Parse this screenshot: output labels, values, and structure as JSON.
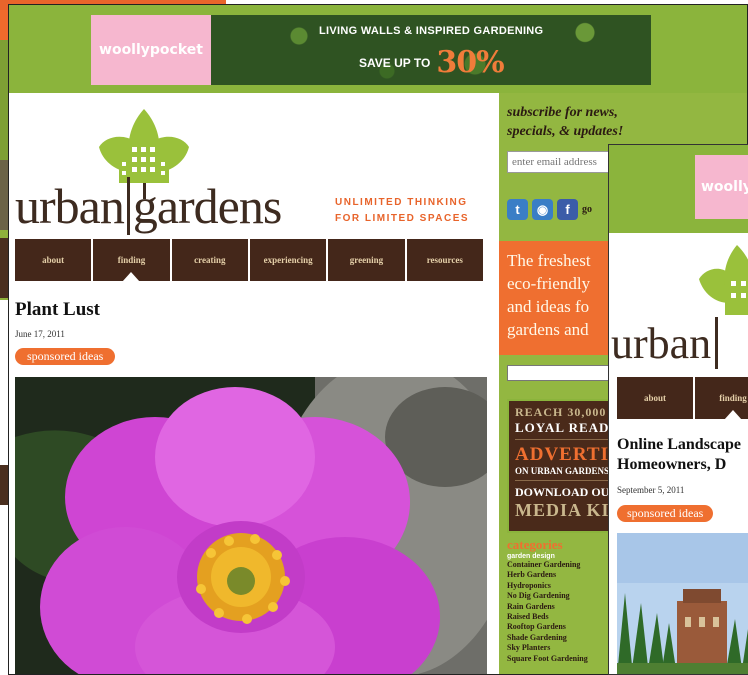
{
  "ad": {
    "logo": "woollypocket",
    "headline": "LIVING WALLS & INSPIRED GARDENING",
    "save_text": "SAVE UP TO",
    "save_percent": "30%"
  },
  "site": {
    "title_part1": "urban",
    "title_part2": "gardens",
    "tagline_line1": "UNLIMITED THINKING",
    "tagline_line2": "FOR LIMITED SPACES"
  },
  "nav": {
    "items": [
      {
        "label": "about"
      },
      {
        "label": "finding"
      },
      {
        "label": "creating"
      },
      {
        "label": "experiencing"
      },
      {
        "label": "greening"
      },
      {
        "label": "resources"
      }
    ]
  },
  "post": {
    "title": "Plant Lust",
    "date": "June 17, 2011",
    "tag": "sponsored ideas"
  },
  "sidebar": {
    "subscribe_line1": "subscribe for news,",
    "subscribe_line2": "specials, & updates!",
    "email_placeholder": "enter email address",
    "social_more": "go",
    "promo_line1": "The freshest",
    "promo_line2": "eco-friendly",
    "promo_line3": "and ideas fo",
    "promo_line4": "gardens and",
    "advert": {
      "reach": "REACH 30,000",
      "readers": "LOYAL READERS",
      "advertise": "ADVERTISE",
      "on_urban": "ON URBAN GARDENS",
      "download": "DOWNLOAD OUR",
      "media_kit": "MEDIA KIT"
    },
    "categories_heading": "categories",
    "categories_sub": "garden design",
    "categories": [
      "Container Gardening",
      "Herb Gardens",
      "Hydroponics",
      "No Dig Gardening",
      "Rain Gardens",
      "Raised Beds",
      "Rooftop Gardens",
      "Shade Gardening",
      "Sky Planters",
      "Square Foot Gardening"
    ]
  },
  "right_window": {
    "logo": "woollypocket",
    "title": "urban",
    "nav": [
      {
        "label": "about"
      },
      {
        "label": "finding"
      }
    ],
    "post_title_line1": "Online Landscape",
    "post_title_line2": "Homeowners, D",
    "date": "September 5, 2011",
    "tag": "sponsored ideas"
  },
  "colors": {
    "brand_green": "#8bb43c",
    "accent_orange": "#ef6f30",
    "nav_brown": "#44271a",
    "ad_pink": "#f6b7cf"
  }
}
